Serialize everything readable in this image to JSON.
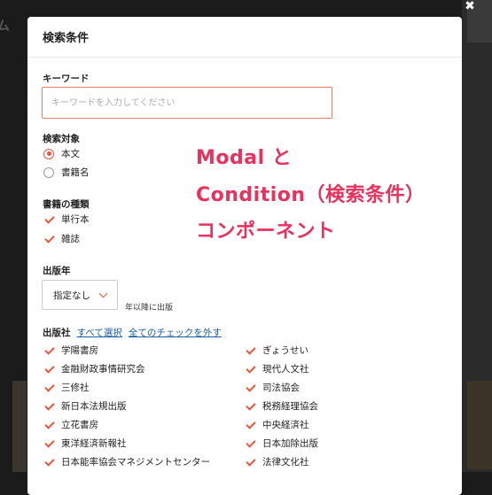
{
  "background": {
    "title_fragment": "ム"
  },
  "close_glyph": "✖",
  "modal": {
    "title": "検索条件",
    "keyword": {
      "label": "キーワード",
      "placeholder": "キーワードを入力してください",
      "value": ""
    },
    "target": {
      "label": "検索対象",
      "options": [
        {
          "label": "本文",
          "selected": true
        },
        {
          "label": "書籍名",
          "selected": false
        }
      ]
    },
    "book_type": {
      "label": "書籍の種類",
      "options": [
        {
          "label": "単行本",
          "checked": true
        },
        {
          "label": "雑誌",
          "checked": true
        }
      ]
    },
    "year": {
      "label": "出版年",
      "selected": "指定なし",
      "suffix": "年以降に出版"
    },
    "publisher": {
      "label": "出版社",
      "select_all": "すべて選択",
      "clear_all": "全てのチェックを外す",
      "left": [
        "学陽書房",
        "金融財政事情研究会",
        "三修社",
        "新日本法規出版",
        "立花書房",
        "東洋経済新報社",
        "日本能率協会マネジメントセンター"
      ],
      "right": [
        "ぎょうせい",
        "現代人文社",
        "司法協会",
        "税務経理協会",
        "中央経済社",
        "日本加除出版",
        "法律文化社"
      ]
    }
  },
  "overlay": {
    "line1": "Modal と",
    "line2": "Condition（検索条件）",
    "line3": "コンポーネント",
    "color": "#e8315c"
  },
  "colors": {
    "accent": "#e8553b",
    "link": "#1a5fa8"
  }
}
